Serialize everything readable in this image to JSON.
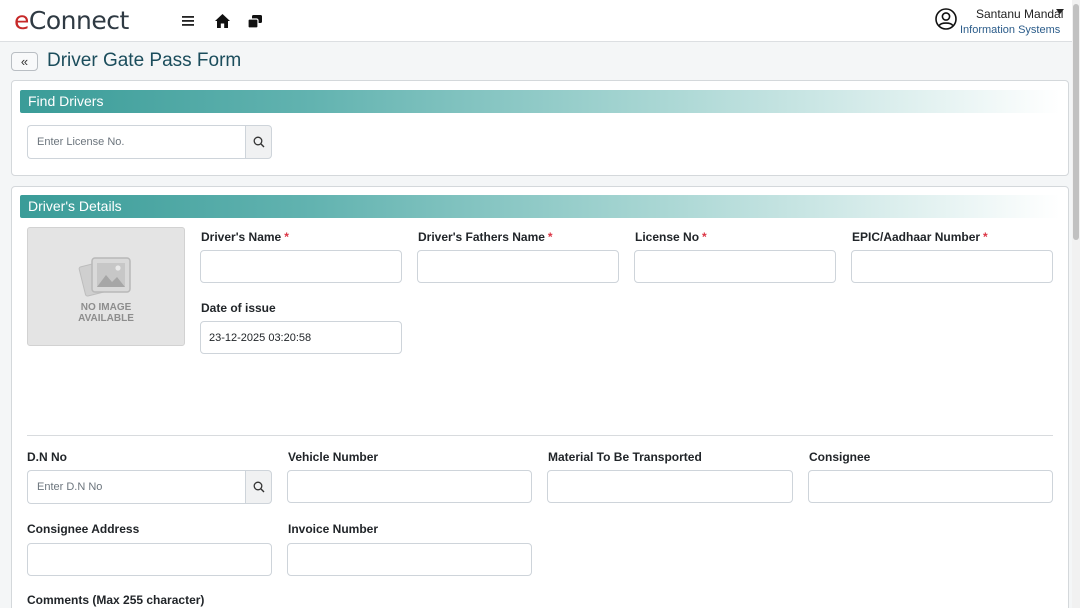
{
  "header": {
    "logo_first": "e",
    "logo_rest": "Connect",
    "icons": [
      "menu-icon",
      "home-icon",
      "copy-window-icon",
      "user-circle-icon"
    ],
    "user_name": "Santanu Mandal",
    "user_dept": "Information Systems"
  },
  "page": {
    "back_label": "«",
    "title": "Driver Gate Pass Form"
  },
  "find": {
    "heading": "Find Drivers",
    "license_placeholder": "Enter License No."
  },
  "details": {
    "heading": "Driver's Details",
    "photo_text_1": "NO IMAGE",
    "photo_text_2": "AVAILABLE",
    "driver_name_label": "Driver's Name",
    "fathers_name_label": "Driver's Fathers Name",
    "license_no_label": "License No",
    "epic_label": "EPIC/Aadhaar Number",
    "required_mark": "*",
    "date_issue_label": "Date of issue",
    "date_issue_value": "23-12-2025 03:20:58",
    "dn_label": "D.N No",
    "dn_placeholder": "Enter D.N No",
    "vehicle_label": "Vehicle Number",
    "material_label": "Material To Be Transported",
    "consignee_label": "Consignee",
    "consignee_address_label": "Consignee Address",
    "invoice_label": "Invoice Number",
    "comments_label": "Comments (Max 255 character)"
  },
  "colors": {
    "accent": "#3a9c98",
    "title": "#1b4d5c",
    "required": "#dc3545",
    "logo_e": "#c62828"
  }
}
